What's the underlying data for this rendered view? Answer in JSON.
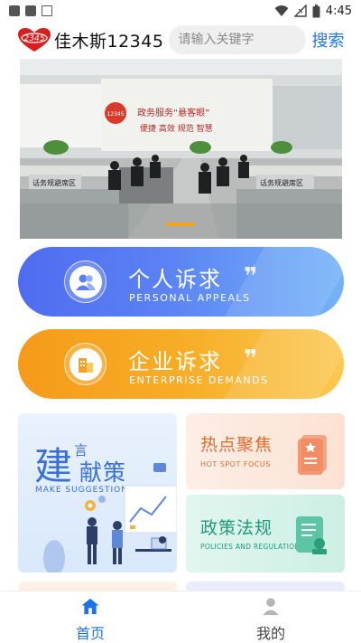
{
  "status_bar": {
    "time": "4:45"
  },
  "header": {
    "logo_text": "12345",
    "title": "佳木斯12345",
    "search_placeholder": "请输入关键字",
    "search_button": "搜索"
  },
  "banner": {
    "wall_slogan_1": "政务服务“悬客眼”",
    "wall_slogan_2": "便捷 高效 规范 智慧",
    "sign_left": "话务规避席区",
    "sign_right": "话务规避席区"
  },
  "appeals": {
    "personal": {
      "title": "个人诉求",
      "subtitle": "PERSONAL APPEALS"
    },
    "enterprise": {
      "title": "企业诉求",
      "subtitle": "ENTERPRISE DEMANDS"
    }
  },
  "tiles": {
    "suggestions": {
      "char_big": "建",
      "char_small": "言",
      "chars_rest": "献策",
      "subtitle": "MAKE SUGGESTIONS"
    },
    "hot_spot": {
      "title": "热点聚焦",
      "subtitle": "HOT SPOT FOCUS"
    },
    "policies": {
      "title": "政策法规",
      "subtitle": "POLICIES AND REGULATIONS"
    }
  },
  "bottom_nav": [
    {
      "label": "首页",
      "icon": "home-icon",
      "active": true
    },
    {
      "label": "我的",
      "icon": "profile-icon",
      "active": false
    }
  ],
  "colors": {
    "accent": "#1e74e6",
    "blue_pill": "#5b82f4",
    "orange_pill": "#f7ad27",
    "hot_text": "#e76a2b",
    "policy_text": "#1a9c78"
  }
}
